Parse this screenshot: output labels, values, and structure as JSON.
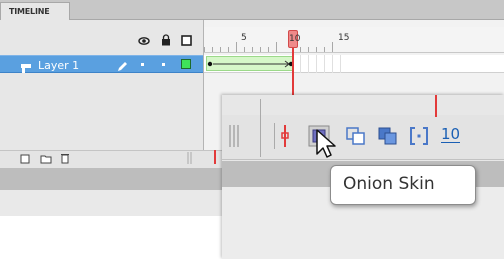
{
  "timeline": {
    "tab_label": "TIMELINE",
    "ruler": {
      "labels": [
        "5",
        "10",
        "15"
      ]
    },
    "layers": [
      {
        "name": "Layer 1"
      }
    ],
    "header_icons": [
      "eye-icon",
      "lock-icon",
      "outline-icon"
    ]
  },
  "zoom": {
    "tooltip": "Onion Skin",
    "frame_number": "10",
    "tools": [
      "center-frame-icon",
      "onion-skin-icon",
      "onion-skin-outlines-icon",
      "edit-multiple-frames-icon",
      "modify-onion-markers-icon"
    ]
  },
  "colors": {
    "layer_selected": "#5aa0e0",
    "playhead": "#e23a3a",
    "tween": "#d6f7c9",
    "frame_number_link": "#1a5fb4"
  }
}
